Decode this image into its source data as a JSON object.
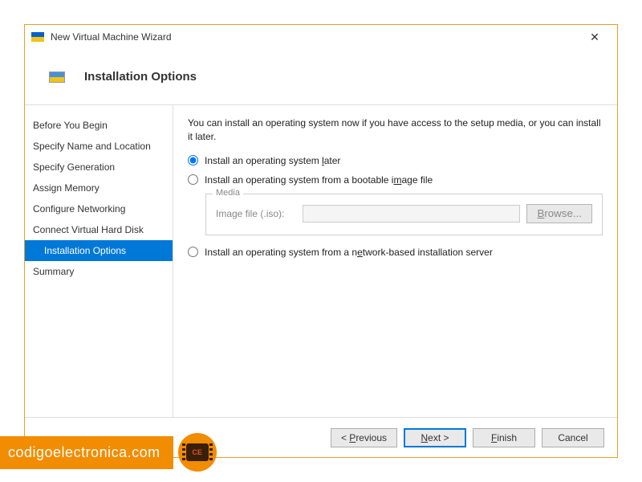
{
  "window": {
    "title": "New Virtual Machine Wizard"
  },
  "header": {
    "title": "Installation Options"
  },
  "sidebar": {
    "items": [
      {
        "label": "Before You Begin",
        "selected": false
      },
      {
        "label": "Specify Name and Location",
        "selected": false
      },
      {
        "label": "Specify Generation",
        "selected": false
      },
      {
        "label": "Assign Memory",
        "selected": false
      },
      {
        "label": "Configure Networking",
        "selected": false
      },
      {
        "label": "Connect Virtual Hard Disk",
        "selected": false
      },
      {
        "label": "Installation Options",
        "selected": true
      },
      {
        "label": "Summary",
        "selected": false
      }
    ]
  },
  "content": {
    "description": "You can install an operating system now if you have access to the setup media, or you can install it later.",
    "options": {
      "later": "Install an operating system later",
      "image": "Install an operating system from a bootable image file",
      "network": "Install an operating system from a network-based installation server"
    },
    "selected": "later",
    "media": {
      "legend": "Media",
      "label": "Image file (.iso):",
      "value": "",
      "browse": "Browse..."
    }
  },
  "footer": {
    "previous": "< Previous",
    "next": "Next >",
    "finish": "Finish",
    "cancel": "Cancel"
  },
  "watermark": {
    "text": "codigoelectronica.com",
    "chip": "CE"
  }
}
